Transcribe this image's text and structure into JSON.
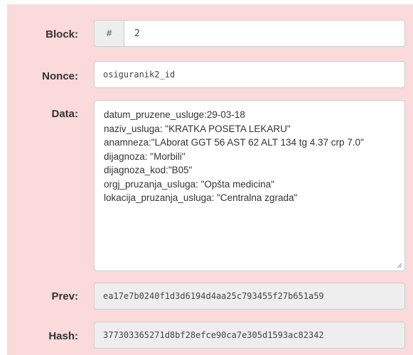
{
  "block": {
    "label": "Block:",
    "addon": "#",
    "value": "2"
  },
  "nonce": {
    "label": "Nonce:",
    "value": "osiguranik2_id"
  },
  "data": {
    "label": "Data:",
    "value": "datum_pruzene_usluge:29-03-18\nnaziv_usluga: \"KRATKA POSETA LEKARU\"\nanamneza:\"LAborat GGT 56 AST 62 ALT 134 tg 4.37 crp 7.0\"\ndijagnoza: \"Morbili\"\ndijagnoza_kod:\"B05\"\norgj_pruzanja_usluga: \"Opšta medicina\"\nlokacija_pruzanja_usluga: \"Centralna zgrada\""
  },
  "prev": {
    "label": "Prev:",
    "value": "ea17e7b0240f1d3d6194d4aa25c793455f27b651a59"
  },
  "hash": {
    "label": "Hash:",
    "value": "377303365271d8bf28efce90ca7e305d1593ac82342"
  },
  "colors": {
    "card_background": "#fadada",
    "field_background": "#ffffff",
    "readonly_background": "#eeeeee",
    "border": "#cfcfcf"
  },
  "icons": {
    "resize": "resize-handle-icon"
  }
}
